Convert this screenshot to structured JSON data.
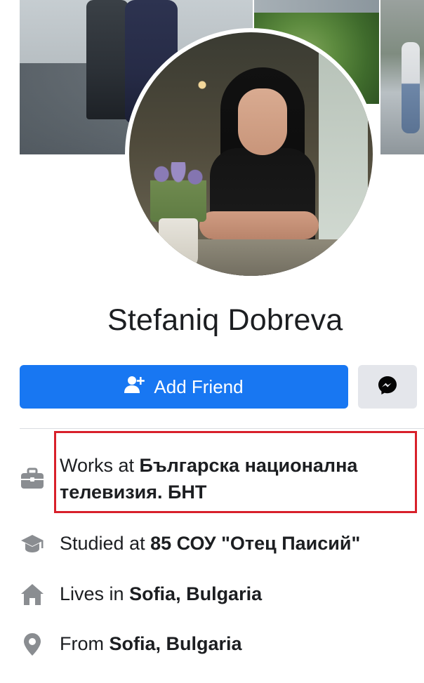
{
  "profile": {
    "name": "Stefaniq Dobreva"
  },
  "actions": {
    "add_friend_label": "Add Friend"
  },
  "info": {
    "work": {
      "prefix": "Works at ",
      "value_line1": "Българска национална",
      "value_line2": "телевизия. БНТ"
    },
    "education": {
      "prefix": "Studied at ",
      "value": "85 СОУ \"Отец Паисий\""
    },
    "lives": {
      "prefix": "Lives in ",
      "value": "Sofia, Bulgaria"
    },
    "from": {
      "prefix": "From ",
      "value": "Sofia, Bulgaria"
    }
  },
  "icons": {
    "add_friend": "add-person-icon",
    "messenger": "messenger-icon",
    "work": "briefcase-icon",
    "education": "graduation-cap-icon",
    "lives": "home-icon",
    "from": "location-pin-icon"
  },
  "colors": {
    "primary": "#1877f2",
    "secondary_button": "#e4e6eb",
    "icon_gray": "#8a8d91",
    "highlight_border": "#d8202a",
    "text": "#1c1e21"
  }
}
